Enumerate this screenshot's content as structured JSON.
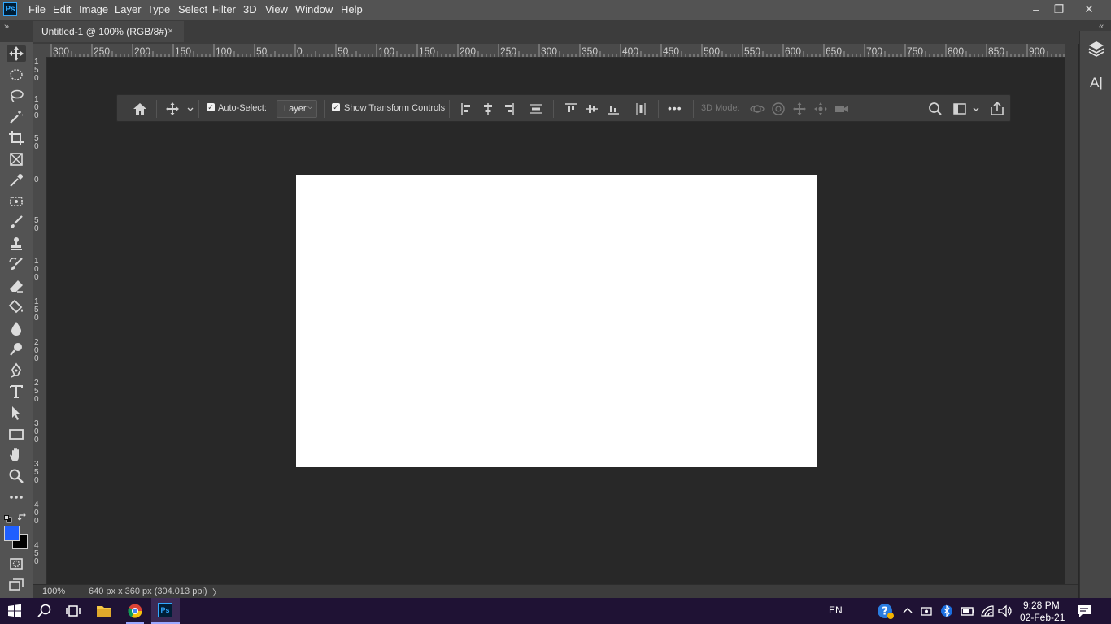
{
  "app": {
    "logo_text": "Ps"
  },
  "menu": {
    "items": [
      "File",
      "Edit",
      "Image",
      "Layer",
      "Type",
      "Select",
      "Filter",
      "3D",
      "View",
      "Window",
      "Help"
    ]
  },
  "window_controls": {
    "minimize": "–",
    "restore": "❐",
    "close": "✕"
  },
  "document_tab": {
    "title": "Untitled-1 @ 100% (RGB/8#)",
    "close": "×"
  },
  "collapse": {
    "left": "»",
    "right": "«"
  },
  "tools": [
    "move-tool",
    "elliptical-marquee-tool",
    "lasso-tool",
    "magic-wand-tool",
    "crop-tool",
    "frame-tool",
    "eyedropper-tool",
    "patch-tool",
    "brush-tool",
    "clone-stamp-tool",
    "history-brush-tool",
    "eraser-tool",
    "paint-bucket-tool",
    "blur-tool",
    "dodge-tool",
    "pen-tool",
    "type-tool",
    "path-selection-tool",
    "rectangle-tool",
    "hand-tool",
    "zoom-tool",
    "more-tools"
  ],
  "colors": {
    "foreground": "#1f5fff",
    "background": "#000000",
    "accent": "#31a8ff",
    "ui_dark": "#282828"
  },
  "ruler": {
    "top": [
      "300",
      "250",
      "200",
      "150",
      "100",
      "50",
      "0",
      "50",
      "100",
      "150",
      "200",
      "250",
      "300",
      "350",
      "400",
      "450",
      "500",
      "550",
      "600",
      "650",
      "700",
      "750",
      "800",
      "850",
      "900"
    ],
    "left": [
      "1 5 0",
      "1 0 0",
      "5 0",
      "0",
      "5 0",
      "1 0 0",
      "1 5 0",
      "2 0 0",
      "2 5 0",
      "3 0 0",
      "3 5 0",
      "4 0 0",
      "4 5 0"
    ]
  },
  "options_bar": {
    "auto_select_label": "Auto-Select:",
    "auto_select_checked": true,
    "layer_option": "Layer",
    "show_transform_label": "Show Transform Controls",
    "show_transform_checked": true,
    "more": "•••",
    "three_d_mode_label": "3D Mode:"
  },
  "status": {
    "zoom": "100%",
    "doc_info": "640 px x 360 px (304.013 ppi)",
    "arrow": "〉"
  },
  "right_panel": {
    "icons": [
      "layers-icon",
      "character-icon"
    ],
    "character_text": "A|"
  },
  "taskbar": {
    "language": "EN",
    "time": "9:28 PM",
    "date": "02-Feb-21"
  }
}
